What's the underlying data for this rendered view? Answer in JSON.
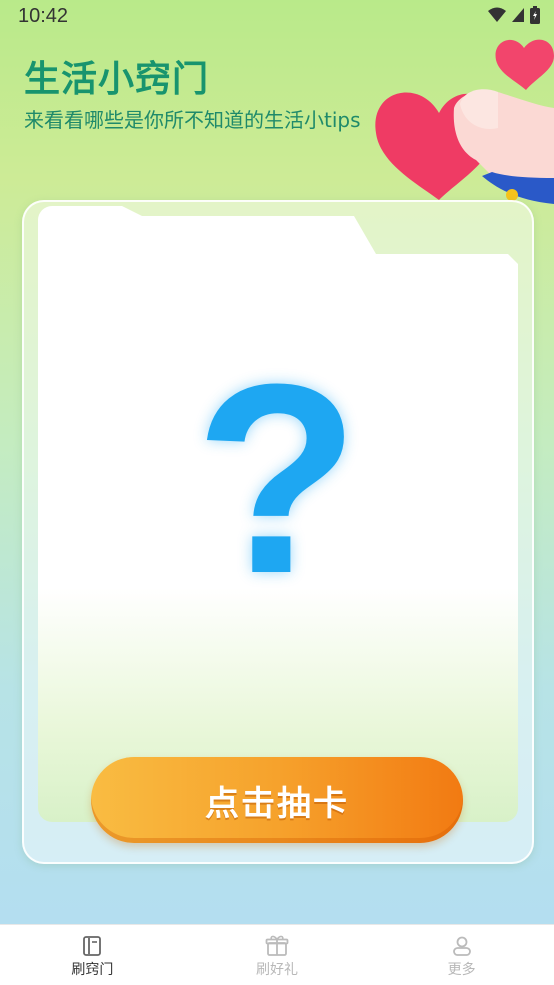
{
  "status_bar": {
    "time": "10:42"
  },
  "header": {
    "title": "生活小窍门",
    "subtitle": "来看看哪些是你所不知道的生活小tips"
  },
  "card": {
    "mystery_symbol": "?",
    "draw_button_label": "点击抽卡"
  },
  "tabbar": {
    "items": [
      {
        "label": "刷窍门",
        "icon": "book-icon",
        "active": true
      },
      {
        "label": "刷好礼",
        "icon": "gift-icon",
        "active": false
      },
      {
        "label": "更多",
        "icon": "user-icon",
        "active": false
      }
    ]
  },
  "colors": {
    "title": "#18946e",
    "question_mark": "#1ea7f2",
    "button_start": "#f9bc42",
    "button_end": "#f27a12"
  }
}
